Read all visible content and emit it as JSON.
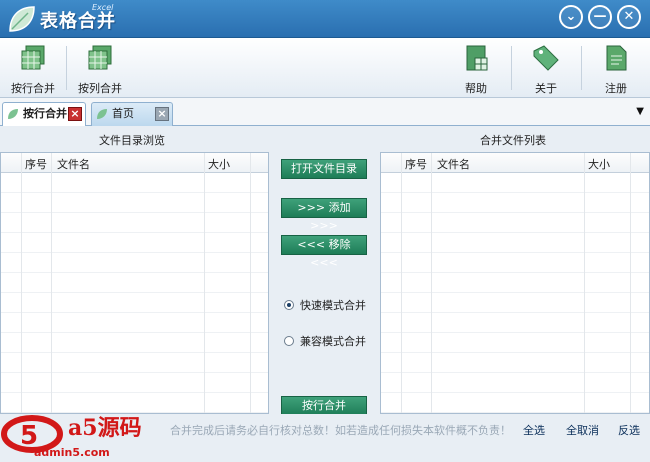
{
  "window": {
    "title": "表格合并",
    "subtitle": "Excel",
    "controls": {
      "collapse": "⌄",
      "minimize": "—",
      "close": "✕"
    }
  },
  "toolbar": {
    "row_merge": "按行合并",
    "col_merge": "按列合并",
    "help": "帮助",
    "about": "关于",
    "register": "注册"
  },
  "tabs": [
    {
      "label": "按行合并",
      "active": true
    },
    {
      "label": "首页",
      "active": false
    }
  ],
  "tab_dropdown": "▼",
  "left_panel": {
    "title": "文件目录浏览",
    "columns": [
      "序号",
      "文件名",
      "大小"
    ]
  },
  "right_panel": {
    "title": "合并文件列表",
    "columns": [
      "序号",
      "文件名",
      "大小"
    ]
  },
  "middle": {
    "open_dir": "打开文件目录",
    "add": ">>> 添加 >>>",
    "remove": "<<< 移除 <<<",
    "mode_fast": "快速模式合并",
    "mode_compat": "兼容模式合并",
    "mode_selected": "fast",
    "merge": "按行合并"
  },
  "status": {
    "notice": "合并完成后请务必自行核对总数！如若造成任何损失本软件概不负责！",
    "select_all": "全选",
    "deselect_all": "全取消",
    "invert": "反选"
  },
  "watermark": {
    "brand": "a5源码",
    "url": "admin5.com"
  },
  "colors": {
    "accent_blue": "#2a6fb0",
    "button_green": "#1e7d57",
    "close_red": "#c83030"
  }
}
